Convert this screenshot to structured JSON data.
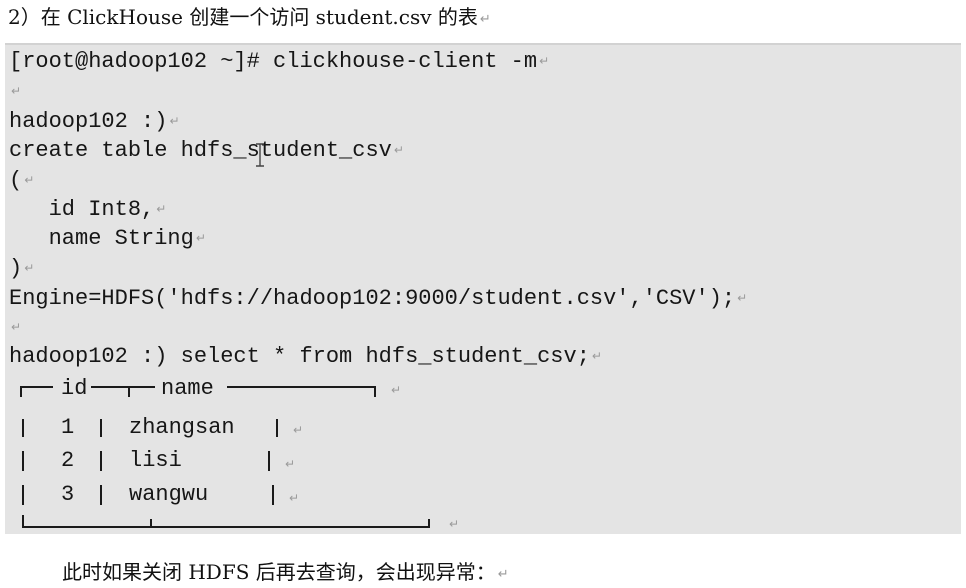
{
  "heading": "2）在 ClickHouse 创建一个访问 student.csv 的表",
  "paragraph_mark": "↵",
  "code_lines": [
    "[root@hadoop102 ~]# clickhouse-client -m",
    "",
    "hadoop102 :)",
    "create table hdfs_student_csv",
    "(",
    "   id Int8,",
    "   name String",
    ")",
    "Engine=HDFS('hdfs://hadoop102:9000/student.csv','CSV');",
    "",
    "hadoop102 :) select * from hdfs_student_csv;"
  ],
  "result_table": {
    "columns": [
      "id",
      "name"
    ],
    "rows": [
      [
        "1",
        "zhangsan"
      ],
      [
        "2",
        "lisi"
      ],
      [
        "3",
        "wangwu"
      ]
    ]
  },
  "footer": "此时如果关闭 HDFS 后再去查询，会出现异常："
}
